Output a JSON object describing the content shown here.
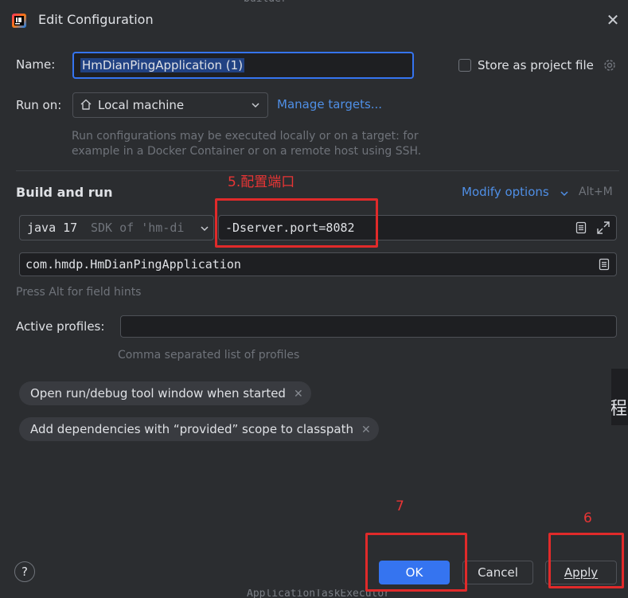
{
  "window": {
    "title": "Edit Configuration"
  },
  "form": {
    "name_label": "Name:",
    "name_value": "HmDianPingApplication (1)",
    "store_label": "Store as project file",
    "runon_label": "Run on:",
    "runon_value": "Local machine",
    "manage_targets": "Manage targets...",
    "runon_hint_line1": "Run configurations may be executed locally or on a target: for",
    "runon_hint_line2": "example in a Docker Container or on a remote host using SSH."
  },
  "build": {
    "section_title": "Build and run",
    "modify_options": "Modify options",
    "modify_shortcut": "Alt+M",
    "jdk_java": "java 17",
    "jdk_sdk": "SDK of 'hm-di",
    "vm_options": "-Dserver.port=8082",
    "main_class": "com.hmdp.HmDianPingApplication",
    "field_hint": "Press Alt for field hints",
    "profiles_label": "Active profiles:",
    "profiles_value": "",
    "profiles_hint": "Comma separated list of profiles"
  },
  "chips": [
    {
      "label": "Open run/debug tool window when started"
    },
    {
      "label": "Add dependencies with “provided” scope to classpath"
    }
  ],
  "footer": {
    "help": "?",
    "ok": "OK",
    "cancel": "Cancel",
    "apply": "Apply"
  },
  "annotations": {
    "port_note": "5.配置端口",
    "ok_step": "7",
    "apply_step": "6"
  },
  "background": {
    "top_peek": "builder",
    "bottom_peek": "ApplicationTaskExecutor",
    "side_glyph": "程"
  },
  "colors": {
    "accent": "#3574f0",
    "link": "#4f8fe6",
    "annotation": "#e02a2a",
    "dialog_bg": "#2b2d30"
  }
}
